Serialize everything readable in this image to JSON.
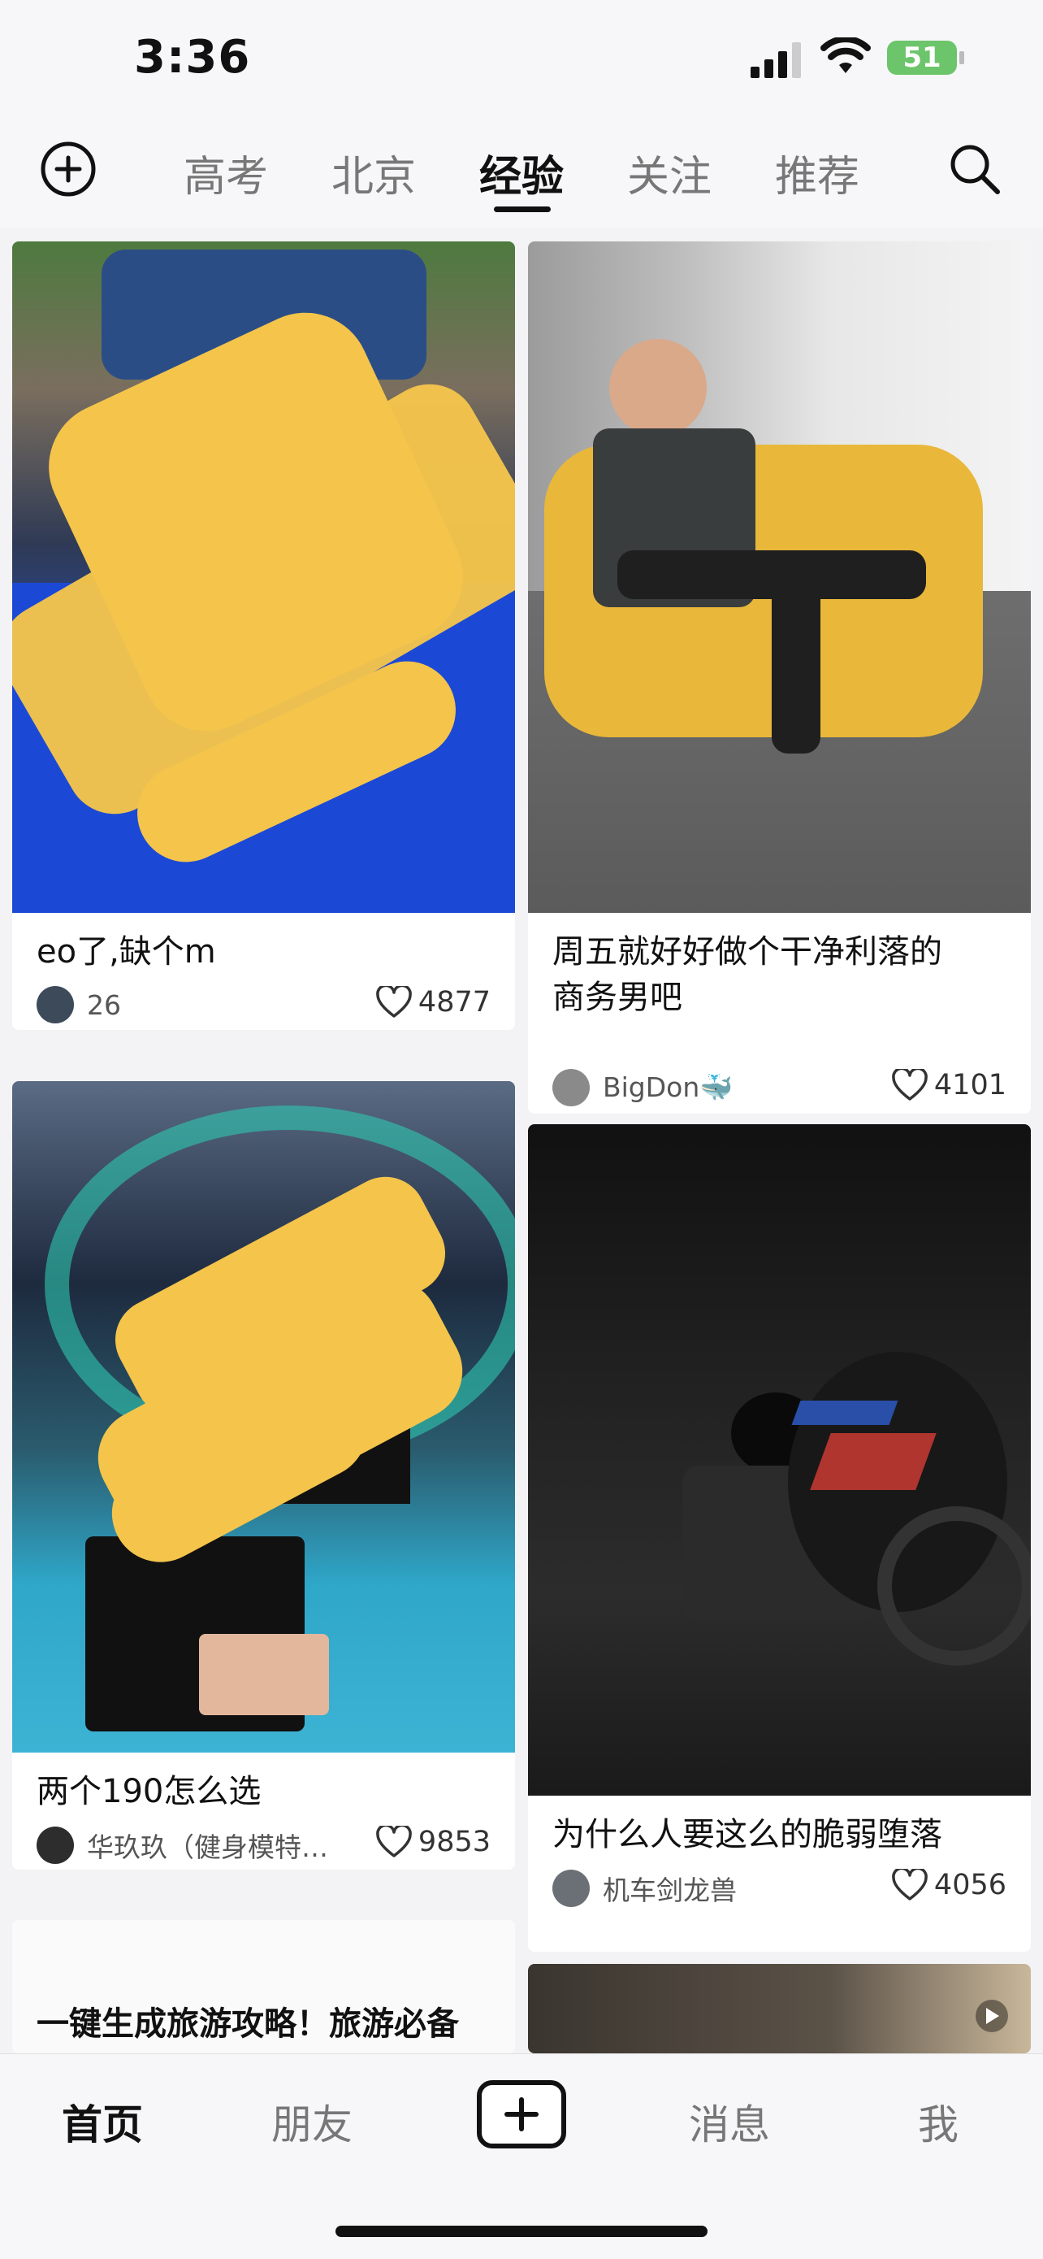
{
  "status": {
    "time": "3:36",
    "battery": "51"
  },
  "top_tabs": [
    {
      "label": "高考",
      "active": false
    },
    {
      "label": "北京",
      "active": false
    },
    {
      "label": "经验",
      "active": true
    },
    {
      "label": "关注",
      "active": false
    },
    {
      "label": "推荐",
      "active": false
    }
  ],
  "feed": {
    "left": [
      {
        "title": "eo了,缺个m",
        "author": "26",
        "likes": "4877"
      },
      {
        "title": "两个190怎么选",
        "author": "华玖玖（健身模特…",
        "likes": "9853"
      },
      {
        "title": "一键生成旅游攻略！旅游必备"
      }
    ],
    "right": [
      {
        "title_line1": "周五就好好做个干净利落的",
        "title_line2": "商务男吧",
        "author": "BigDon🐳",
        "likes": "4101"
      },
      {
        "title": "为什么人要这么的脆弱堕落",
        "author": "机车剑龙兽",
        "likes": "4056"
      }
    ]
  },
  "bottom_nav": [
    {
      "label": "首页",
      "active": true
    },
    {
      "label": "朋友",
      "active": false
    },
    {
      "label": "消息",
      "active": false
    },
    {
      "label": "我",
      "active": false
    }
  ],
  "icons": {
    "add": "plus-circle-icon",
    "search": "search-icon",
    "like": "heart-outline-icon",
    "publish": "plus-square-icon",
    "play": "play-icon"
  }
}
